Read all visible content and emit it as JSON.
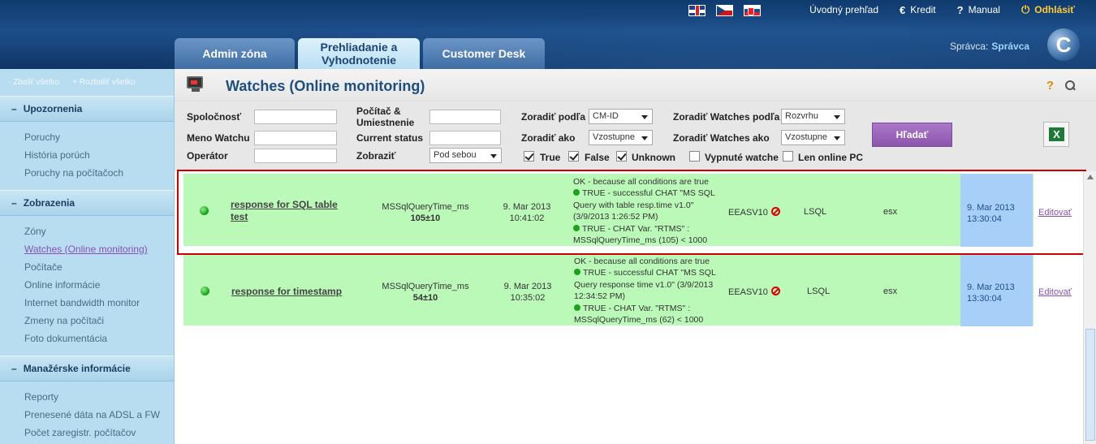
{
  "header": {
    "nav": {
      "home": "Úvodný prehľad",
      "credit": "Kredit",
      "manual": "Manual",
      "logout": "Odhlásiť"
    },
    "tabs": [
      {
        "label": "Admin zóna"
      },
      {
        "label": "Prehliadanie a Vyhodnotenie"
      },
      {
        "label": "Customer Desk"
      }
    ],
    "admin_label": "Správca:",
    "admin_name": "Správca"
  },
  "sidebar": {
    "collapse_all": "- Zbaliť všetko",
    "expand_all": "+ Rozbaliť všetko",
    "sections": [
      {
        "title": "Upozornenia",
        "items": [
          "Poruchy",
          "História porúch",
          "Poruchy na počítačoch"
        ]
      },
      {
        "title": "Zobrazenia",
        "items": [
          "Zóny",
          "Watches (Online monitoring)",
          "Počítače",
          "Online informácie",
          "Internet bandwidth monitor",
          "Zmeny na počítači",
          "Foto dokumentácia"
        ]
      },
      {
        "title": "Manažérske informácie",
        "items": [
          "Reporty",
          "Prenesené dáta na ADSL a FW",
          "Počet zaregistr. počítačov"
        ]
      }
    ]
  },
  "page": {
    "title": "Watches (Online monitoring)"
  },
  "filters": {
    "company_label": "Spoločnosť",
    "watch_name_label": "Meno Watchu",
    "operator_label": "Operátor",
    "pc_label": "Počítač & Umiestnenie",
    "current_status_label": "Current status",
    "display_label": "Zobraziť",
    "display_value": "Pod sebou",
    "sort_by_label": "Zoradiť podľa",
    "sort_by_value": "CM-ID",
    "sort_as_label": "Zoradiť ako",
    "sort_as_value": "Vzostupne",
    "sort_watches_by_label": "Zoradiť Watches podľa",
    "sort_watches_by_value": "Rozvrhu",
    "sort_watches_as_label": "Zoradiť Watches ako",
    "sort_watches_as_value": "Vzostupne",
    "true_label": "True",
    "false_label": "False",
    "unknown_label": "Unknown",
    "disabled_label": "Vypnuté watche",
    "online_only_label": "Len online PC",
    "search_button": "Hľadať"
  },
  "rows": [
    {
      "name": "response for SQL table test",
      "metric": "MSSqlQueryTime_ms",
      "value": "105±10",
      "date": "9. Mar 2013",
      "time": "10:41:02",
      "status_line1": "OK - because all conditions are true",
      "status_line2": "TRUE - successful CHAT \"MS SQL Query with table resp.time v1.0\" (3/9/2013 1:26:52 PM)",
      "status_line3": "TRUE - CHAT Var. \"RTMS\" : MSSqlQueryTime_ms (105) < 1000",
      "computer": "EEASV10",
      "location": "LSQL",
      "type": "esx",
      "next_date": "9. Mar 2013",
      "next_time": "13:30:04",
      "edit": "Editovať"
    },
    {
      "name": "response for timestamp",
      "metric": "MSSqlQueryTime_ms",
      "value": "54±10",
      "date": "9. Mar 2013",
      "time": "10:35:02",
      "status_line1": "OK - because all conditions are true",
      "status_line2": "TRUE - successful CHAT \"MS SQL Query response time v1.0\" (3/9/2013 12:34:52 PM)",
      "status_line3": "TRUE - CHAT Var. \"RTMS\" : MSSqlQueryTime_ms (62) < 1000",
      "computer": "EEASV10",
      "location": "LSQL",
      "type": "esx",
      "next_date": "9. Mar 2013",
      "next_time": "13:30:04",
      "edit": "Editovať"
    }
  ]
}
